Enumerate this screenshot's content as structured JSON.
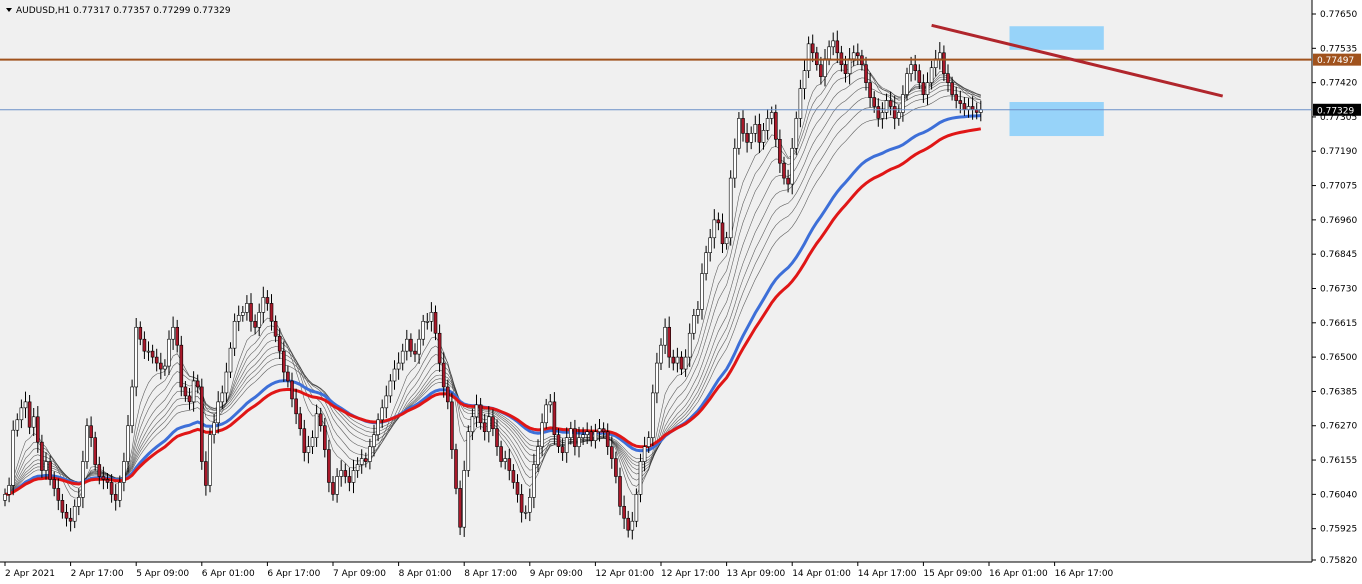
{
  "colors": {
    "background": "#f0f0f0",
    "axis_background": "#ffffff",
    "candle_bull_body": "#ffffff",
    "candle_bear_body": "#a8192a",
    "candle_bull_alt": "#2e8b2e",
    "candle_wick": "#000000",
    "resistance_line": "#a0521d",
    "bid_line": "#6b8fc7",
    "trendline": "#b0262c",
    "zone_fill": "#87cefa",
    "ma_thin": "#303030",
    "ma_blue": "#3d6fd8",
    "ma_red": "#e01616"
  },
  "chart_data": {
    "type": "candlestick",
    "symbol": "AUDUSD",
    "timeframe": "H1",
    "header": {
      "symbol_text": "AUDUSD,H1",
      "ohlc_text": "0.77317 0.77357 0.77299 0.77329"
    },
    "y_axis": {
      "ylim": [
        0.7582,
        0.766
      ],
      "ticks": [
        "0.77650",
        "0.77535",
        "0.77420",
        "0.77305",
        "0.77190",
        "0.77075",
        "0.76960",
        "0.76845",
        "0.76730",
        "0.76615",
        "0.76500",
        "0.76385",
        "0.76270",
        "0.76155",
        "0.76040",
        "0.75925",
        "0.75820"
      ],
      "tick_values": [
        0.7765,
        0.77535,
        0.7742,
        0.77305,
        0.7719,
        0.77075,
        0.7696,
        0.76845,
        0.7673,
        0.76615,
        0.765,
        0.76385,
        0.7627,
        0.76155,
        0.7604,
        0.75925,
        0.7582
      ]
    },
    "x_axis": {
      "ticks": [
        "2 Apr 2021",
        "2 Apr 17:00",
        "5 Apr 09:00",
        "6 Apr 01:00",
        "6 Apr 17:00",
        "7 Apr 09:00",
        "8 Apr 01:00",
        "8 Apr 17:00",
        "9 Apr 09:00",
        "12 Apr 01:00",
        "12 Apr 17:00",
        "13 Apr 09:00",
        "14 Apr 01:00",
        "14 Apr 17:00",
        "15 Apr 09:00",
        "16 Apr 01:00",
        "16 Apr 17:00"
      ],
      "tick_bar_index": [
        0,
        16,
        32,
        48,
        64,
        80,
        96,
        112,
        128,
        144,
        160,
        176,
        192,
        208,
        224,
        240,
        256
      ]
    },
    "horizontal_lines": [
      {
        "label": "0.77497",
        "value": 0.77497,
        "kind": "resistance"
      },
      {
        "label": "0.77329",
        "value": 0.77329,
        "kind": "bid"
      }
    ],
    "trendline": {
      "from": {
        "bar": 226,
        "value": 0.77612
      },
      "to": {
        "bar": 297,
        "value": 0.77375
      }
    },
    "zones": [
      {
        "bar_from": 245,
        "bar_to": 268,
        "low": 0.7753,
        "high": 0.77609
      },
      {
        "bar_from": 245,
        "bar_to": 268,
        "low": 0.77241,
        "high": 0.77355
      }
    ],
    "close": [
      0.7604,
      0.7607,
      0.76255,
      0.7629,
      0.7633,
      0.7635,
      0.76265,
      0.763,
      0.76215,
      0.7612,
      0.7615,
      0.7609,
      0.7606,
      0.7602,
      0.7598,
      0.7596,
      0.7595,
      0.76,
      0.7603,
      0.7615,
      0.7627,
      0.7623,
      0.7614,
      0.761,
      0.7609,
      0.7608,
      0.7604,
      0.7602,
      0.7608,
      0.7615,
      0.7627,
      0.764,
      0.766,
      0.7656,
      0.7652,
      0.7652,
      0.765,
      0.7648,
      0.7646,
      0.7647,
      0.7656,
      0.766,
      0.7654,
      0.764,
      0.7637,
      0.7635,
      0.7642,
      0.764,
      0.7615,
      0.7607,
      0.7624,
      0.7628,
      0.7635,
      0.7638,
      0.7645,
      0.7653,
      0.7662,
      0.7664,
      0.7665,
      0.7668,
      0.7662,
      0.766,
      0.7665,
      0.767,
      0.7668,
      0.7662,
      0.7657,
      0.7652,
      0.7645,
      0.7642,
      0.7636,
      0.7631,
      0.7626,
      0.7618,
      0.762,
      0.7623,
      0.7631,
      0.7627,
      0.7619,
      0.7608,
      0.7604,
      0.761,
      0.7612,
      0.761,
      0.7608,
      0.7612,
      0.7614,
      0.7616,
      0.7615,
      0.762,
      0.7624,
      0.7629,
      0.7633,
      0.7637,
      0.7642,
      0.7646,
      0.7648,
      0.7652,
      0.7656,
      0.7652,
      0.7651,
      0.7656,
      0.7662,
      0.7662,
      0.7665,
      0.7658,
      0.7648,
      0.764,
      0.7635,
      0.7619,
      0.7606,
      0.7593,
      0.7612,
      0.7625,
      0.763,
      0.7634,
      0.7628,
      0.7625,
      0.763,
      0.7626,
      0.762,
      0.7615,
      0.7616,
      0.7612,
      0.7608,
      0.7604,
      0.7598,
      0.7598,
      0.7603,
      0.7614,
      0.762,
      0.7628,
      0.7634,
      0.7635,
      0.7624,
      0.762,
      0.7618,
      0.7623,
      0.7626,
      0.762,
      0.7623,
      0.7624,
      0.7625,
      0.7622,
      0.7625,
      0.7626,
      0.7625,
      0.762,
      0.7616,
      0.761,
      0.76,
      0.7596,
      0.7592,
      0.7595,
      0.7604,
      0.7615,
      0.762,
      0.7623,
      0.7638,
      0.7648,
      0.7654,
      0.766,
      0.765,
      0.7648,
      0.765,
      0.7646,
      0.765,
      0.7658,
      0.7664,
      0.7666,
      0.7678,
      0.7685,
      0.769,
      0.7696,
      0.7695,
      0.7688,
      0.769,
      0.771,
      0.772,
      0.773,
      0.7725,
      0.7722,
      0.7725,
      0.7728,
      0.7722,
      0.7726,
      0.773,
      0.7732,
      0.7723,
      0.7715,
      0.771,
      0.7708,
      0.772,
      0.773,
      0.774,
      0.7746,
      0.7755,
      0.7752,
      0.7748,
      0.7744,
      0.775,
      0.7754,
      0.7756,
      0.7752,
      0.7748,
      0.7745,
      0.775,
      0.7752,
      0.7751,
      0.7748,
      0.7742,
      0.7737,
      0.7734,
      0.773,
      0.7732,
      0.7736,
      0.7734,
      0.773,
      0.7732,
      0.7738,
      0.7745,
      0.7748,
      0.7746,
      0.7742,
      0.7738,
      0.7742,
      0.7747,
      0.775,
      0.7752,
      0.7745,
      0.7742,
      0.7738,
      0.7736,
      0.7735,
      0.7733,
      0.7734,
      0.7733,
      0.7732,
      0.7733
    ],
    "ma_labels": []
  }
}
